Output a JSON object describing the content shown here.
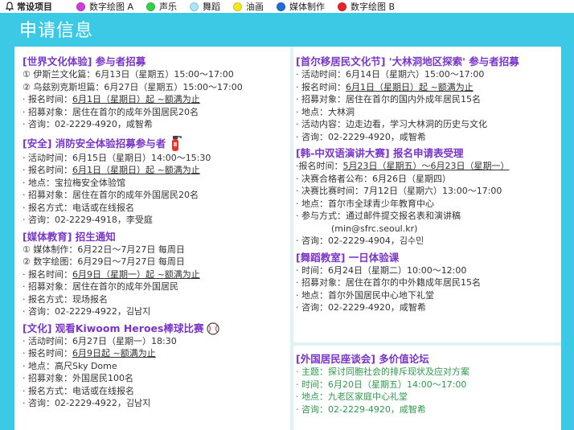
{
  "topbar": {
    "title": "常设项目",
    "items": [
      {
        "label": "数字绘图 A",
        "color": "#d23bdc"
      },
      {
        "label": "声乐",
        "color": "#33d14a"
      },
      {
        "label": "舞蹈",
        "color": "#a7e7f8"
      },
      {
        "label": "油画",
        "color": "#f3e51f"
      },
      {
        "label": "媒体制作",
        "color": "#1f6fd6"
      },
      {
        "label": "数字绘图 B",
        "color": "#e8232a"
      }
    ]
  },
  "header": {
    "title": "申请信息"
  },
  "sections_left": [
    {
      "title": "[世界文化体验] 参与者招募",
      "lines": [
        {
          "pre": "① 伊斯兰文化篇：6月13日（星期五）15:00～17:00"
        },
        {
          "pre": "② 乌兹别克斯坦篇：6月27日（星期五）15:00～17:00"
        },
        {
          "pre": "· 报名时间：",
          "u": "6月1日（星期日）起 ~额满为止"
        },
        {
          "pre": "· 招募对象：居住在首尔的成年外国居民20名"
        },
        {
          "pre": "· 咨询：02-2229-4920，咸智希"
        }
      ]
    },
    {
      "title": "[安全] 消防安全体验招募参与者",
      "icon": "fire-extinguisher-icon",
      "lines": [
        {
          "pre": "· 活动时间：6月15日（星期日）14:00～15:30"
        },
        {
          "pre": "· 报名时间：",
          "u": "6月1日（星期日）起 ~额满为止"
        },
        {
          "pre": "· 地点：宝拉梅安全体验馆"
        },
        {
          "pre": "· 招募对象：居住在首尔的成年外国居民20名"
        },
        {
          "pre": "· 报名方式：电话或在线报名"
        },
        {
          "pre": "· 咨询：02-2229-4918，李受庭"
        }
      ]
    },
    {
      "title": "[媒体教育] 招生通知",
      "lines": [
        {
          "pre": "① 媒体制作：6月22日～7月27日 每周日"
        },
        {
          "pre": "② 数字绘图：6月29日～7月27日 每周日"
        },
        {
          "pre": "· 报名时间：",
          "u": "6月9日（星期一）起 ~额满为止"
        },
        {
          "pre": "· 招募对象：居住在首尔的成年外国居民"
        },
        {
          "pre": "· 报名方式：现场报名"
        },
        {
          "pre": "· 咨询：02-2229-4922，김남지"
        }
      ]
    },
    {
      "title": "[文化] 观看Kiwoom Heroes棒球比赛",
      "icon": "baseball-icon",
      "lines": [
        {
          "pre": "· 活动时间：6月27日（星期一）18:30"
        },
        {
          "pre": "· 报名时间：",
          "u": "6月9日起 ~额满为止"
        },
        {
          "pre": "· 地点：高尺Sky Dome"
        },
        {
          "pre": "· 招募对象：外国居民100名"
        },
        {
          "pre": "· 报名方式：电话或在线报名"
        },
        {
          "pre": "· 咨询：02-2229-4922，김남지"
        }
      ]
    }
  ],
  "sections_right": [
    {
      "title": "[首尔移居民文化节] '大林洞地区探索' 参与者招募",
      "lines": [
        {
          "pre": "· 活动时间：6月14日（星期六）15:00～17:00"
        },
        {
          "pre": "· 报名时间：",
          "u": "6月1日（星期日）起 ~额满为止"
        },
        {
          "pre": "· 招募对象：居住在首尔的国内外成年居民15名"
        },
        {
          "pre": "· 地点：大林洞"
        },
        {
          "pre": "· 活动内容：边走边看，学习大林洞的历史与文化"
        },
        {
          "pre": "· 咨询：02-2229-4920，咸智希"
        }
      ]
    },
    {
      "title": "[韩-中双语演讲大赛] 报名申请表受理",
      "lines": [
        {
          "pre": "·报名时间：",
          "u": "5月23日（星期五）～6月23日（星期一）"
        },
        {
          "pre": "· 决赛合格者公布：6月26日（星期四）"
        },
        {
          "pre": "· 决赛比赛时间：7月12日（星期六）13:00～17:00"
        },
        {
          "pre": "· 地点：首尔市全球青少年教育中心"
        },
        {
          "pre": "· 参与方式：通过邮件提交报名表和演讲稿"
        },
        {
          "pre": "(min@sfrc.seoul.kr)",
          "indent": true
        },
        {
          "pre": "· 咨询：02-2229-4904，김수민"
        }
      ]
    },
    {
      "title": "[舞蹈教室] 一日体验课",
      "lines": [
        {
          "pre": "· 时间：6月24日（星期二）10:00～12:00"
        },
        {
          "pre": "· 招募对象：居住在首尔的中外籍成年居民15名"
        },
        {
          "pre": "· 地点：首尔外国居民中心地下礼堂"
        },
        {
          "pre": "· 咨询：02-2229-4920，咸智希"
        }
      ]
    }
  ],
  "section_bottom": {
    "title": "[外国居民座谈会] 多价值论坛",
    "lines": [
      {
        "pre": "· 主题：探讨同胞社会的排斥现状及应对方案"
      },
      {
        "pre": "· 时间：6月20日（星期五）14:00～17:00"
      },
      {
        "pre": "· 地点：九老区家庭中心礼堂"
      },
      {
        "pre": "· 咨询：02-2229-4920，咸智希"
      }
    ]
  }
}
